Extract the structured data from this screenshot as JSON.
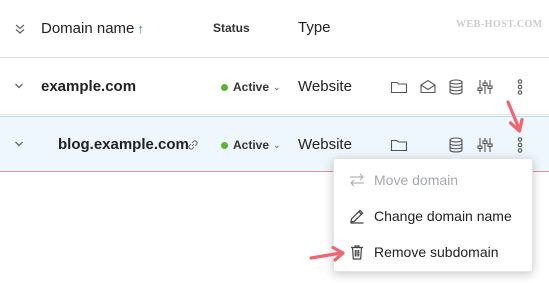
{
  "header": {
    "columns": {
      "domain": "Domain name",
      "sort_indicator": "↑",
      "status": "Status",
      "type": "Type"
    },
    "watermark": "WEB-HOST.COM"
  },
  "rows": [
    {
      "domain": "example.com",
      "status": "Active",
      "type": "Website",
      "actions": [
        "folder-icon",
        "envelope-icon",
        "database-icon",
        "sliders-icon",
        "more-icon"
      ]
    },
    {
      "domain": "blog.example.com",
      "status": "Active",
      "type": "Website",
      "actions": [
        "folder-icon",
        "database-icon",
        "sliders-icon",
        "more-icon"
      ]
    }
  ],
  "menu": {
    "items": [
      {
        "label": "Move domain",
        "icon": "swap-arrows-icon",
        "disabled": true
      },
      {
        "label": "Change domain name",
        "icon": "pencil-icon",
        "disabled": false
      },
      {
        "label": "Remove subdomain",
        "icon": "trash-icon",
        "disabled": false
      }
    ]
  },
  "colors": {
    "accent": "#2f86d6",
    "active": "#5cb531",
    "annotation": "#f0656f",
    "selected_row": "#eef7fd"
  }
}
